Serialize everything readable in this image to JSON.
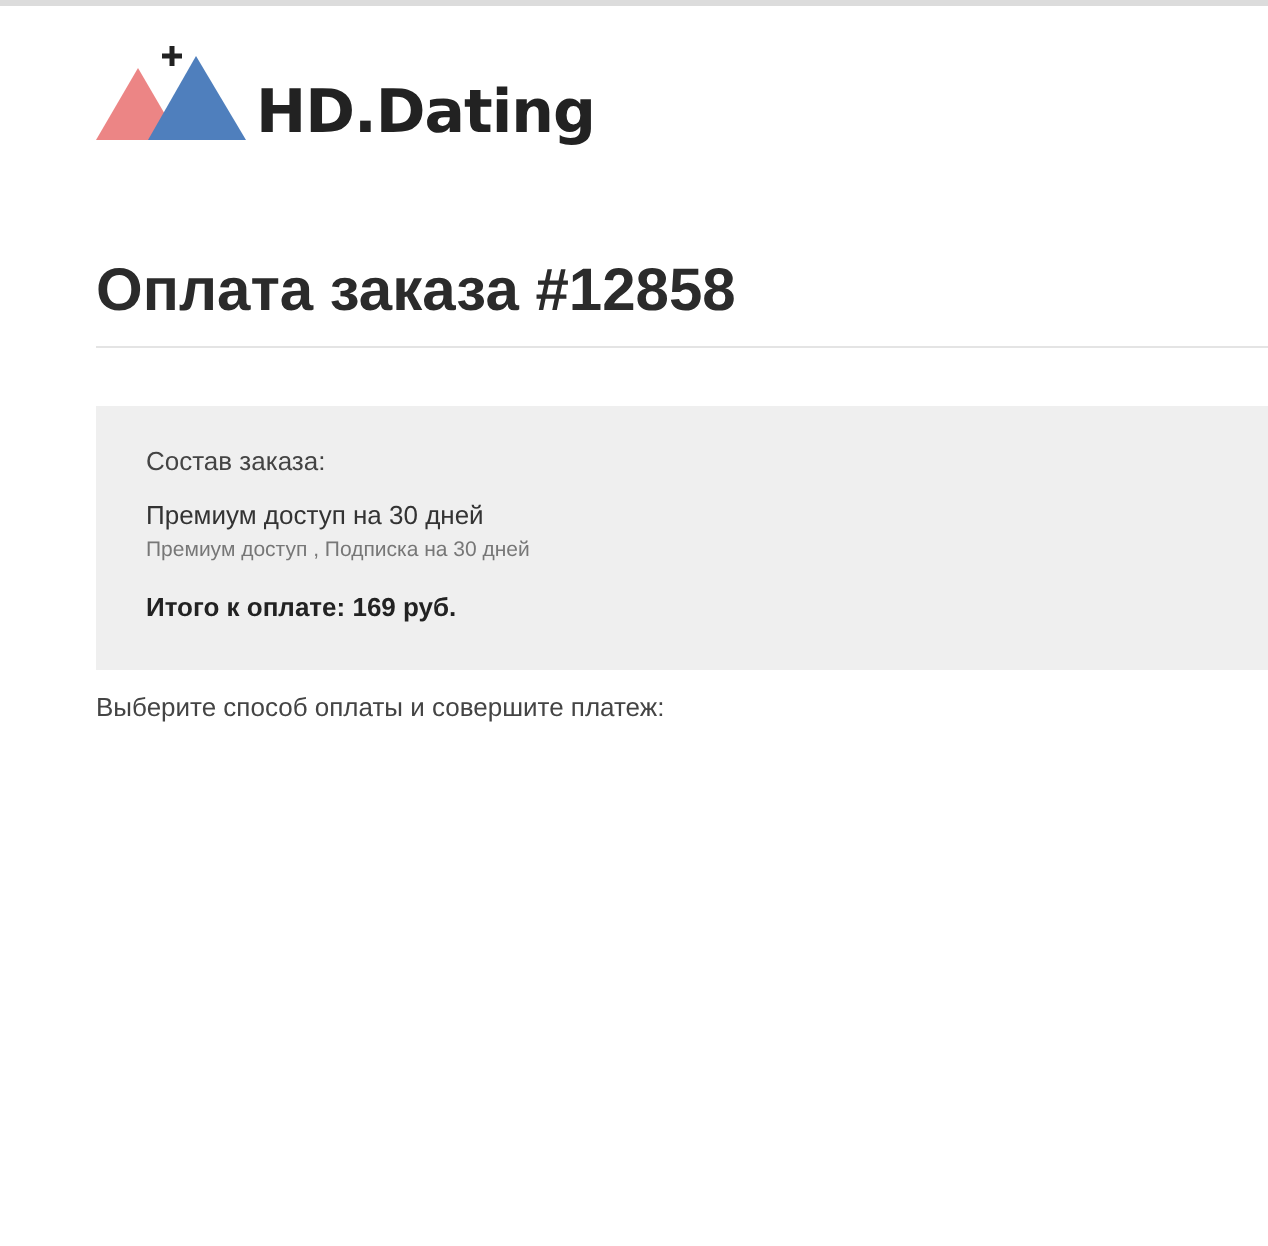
{
  "logo": {
    "text": "HD.Dating"
  },
  "title": "Оплата заказа #12858",
  "order": {
    "heading": "Состав заказа:",
    "item": "Премиум доступ на 30 дней",
    "item_details": "Премиум доступ , Подписка на 30 дней",
    "total": "Итого к оплате: 169 руб."
  },
  "instruction": "Выберите способ оплаты и совершите платеж:"
}
